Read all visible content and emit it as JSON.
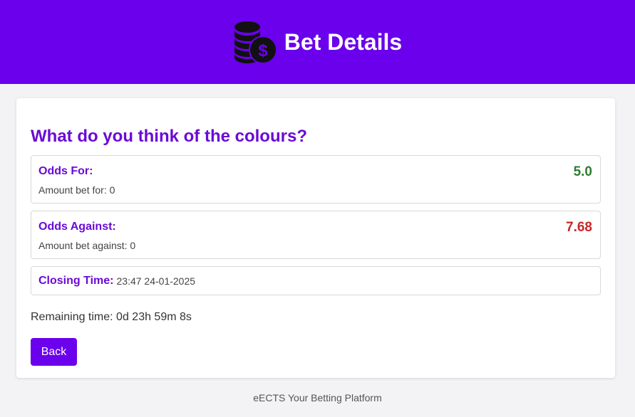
{
  "header": {
    "title": "Bet Details",
    "icon": "coins-dollar-icon",
    "background": "#6a00ec"
  },
  "bet": {
    "question": "What do you think of the colours?",
    "odds_for": {
      "label": "Odds For:",
      "value": "5.0",
      "amount_text": "Amount bet for: 0",
      "color": "#2e7d32"
    },
    "odds_against": {
      "label": "Odds Against:",
      "value": "7.68",
      "amount_text": "Amount bet against: 0",
      "color": "#c62828"
    },
    "closing": {
      "label": "Closing Time:",
      "value": "23:47 24-01-2025"
    },
    "remaining": "Remaining time: 0d 23h 59m 8s"
  },
  "actions": {
    "back_label": "Back"
  },
  "footer": {
    "text": "eECTS Your Betting Platform"
  },
  "colors": {
    "accent": "#6a0ad6",
    "page_background": "#f3f3f6"
  }
}
